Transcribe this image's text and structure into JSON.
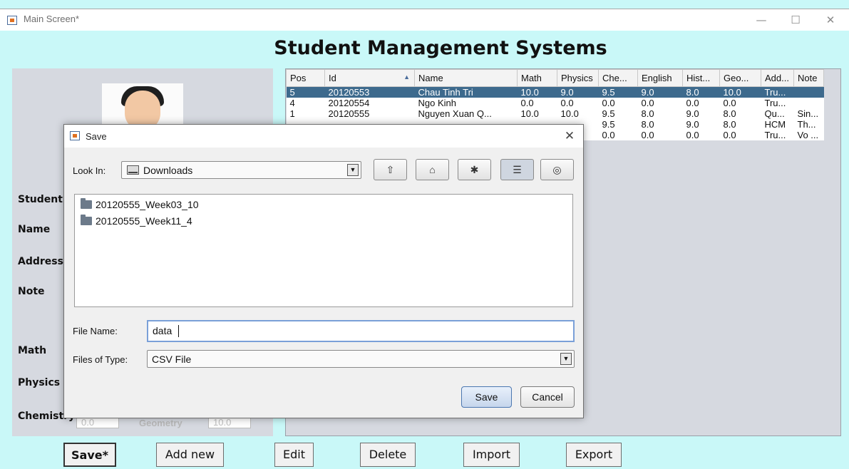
{
  "window": {
    "title": "Main Screen*",
    "controls": {
      "minimize": "—",
      "maximize": "☐",
      "close": "✕"
    }
  },
  "app": {
    "title": "Student Management Systems"
  },
  "form": {
    "labels": {
      "student": "Student",
      "name": "Name",
      "address": "Address",
      "note": "Note",
      "math": "Math",
      "physics": "Physics",
      "chemistry": "Chemistry",
      "geometry": "Geometry"
    },
    "chemistry_value": "0.0",
    "geometry_value": "10.0"
  },
  "table": {
    "columns": [
      "Pos",
      "Id",
      "Name",
      "Math",
      "Physics",
      "Che...",
      "English",
      "Hist...",
      "Geo...",
      "Add...",
      "Note"
    ],
    "sort_indicator": "▲",
    "rows": [
      [
        "5",
        "20120553",
        "Chau Tinh Tri",
        "10.0",
        "9.0",
        "9.5",
        "9.0",
        "8.0",
        "10.0",
        "Tru...",
        ""
      ],
      [
        "4",
        "20120554",
        "Ngo Kinh",
        "0.0",
        "0.0",
        "0.0",
        "0.0",
        "0.0",
        "0.0",
        "Tru...",
        ""
      ],
      [
        "1",
        "20120555",
        "Nguyen Xuan Q...",
        "10.0",
        "10.0",
        "9.5",
        "8.0",
        "9.0",
        "8.0",
        "Qu...",
        "Sin..."
      ],
      [
        "",
        "",
        "",
        "",
        "",
        "9.5",
        "8.0",
        "9.0",
        "8.0",
        "HCM",
        "Th..."
      ],
      [
        "",
        "",
        "",
        "",
        "",
        "0.0",
        "0.0",
        "0.0",
        "0.0",
        "Tru...",
        "Vo ..."
      ]
    ],
    "selected_row": 0
  },
  "buttons": {
    "save": "Save*",
    "add_new": "Add new",
    "edit": "Edit",
    "delete": "Delete",
    "import": "Import",
    "export": "Export"
  },
  "save_dialog": {
    "title": "Save",
    "close": "✕",
    "look_in_label": "Look In:",
    "look_in_value": "Downloads",
    "files": [
      "20120555_Week03_10",
      "20120555_Week11_4"
    ],
    "file_name_label": "File Name:",
    "file_name_value": "data",
    "files_of_type_label": "Files of Type:",
    "files_of_type_value": "CSV File",
    "save_button": "Save",
    "cancel_button": "Cancel"
  }
}
